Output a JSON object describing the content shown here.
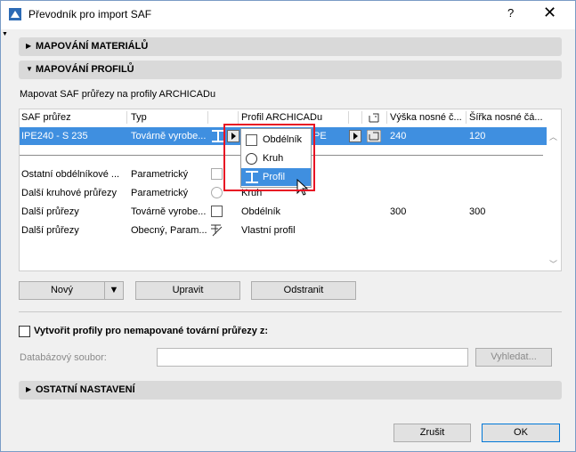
{
  "window": {
    "title": "Převodník pro import SAF",
    "help": "?",
    "close": "✕"
  },
  "sections": {
    "materials": "MAPOVÁNÍ MATERIÁLŮ",
    "profiles": "MAPOVÁNÍ PROFILŮ",
    "other": "OSTATNÍ NASTAVENÍ"
  },
  "map_label": "Mapovat SAF průřezy na profily ARCHICADu",
  "table": {
    "headers": [
      "SAF průřez",
      "Typ",
      "Profil ARCHICADu",
      "Výška nosné č...",
      "Šířka nosné čá..."
    ],
    "selected_row": {
      "saf": "IPE240 - S 235",
      "type": "Továrně vyrobe...",
      "profile_tail": "PE",
      "height": "240",
      "width": "120"
    },
    "rows": [
      {
        "saf": "Ostatní obdélníkové ...",
        "type": "Parametrický",
        "profile": "",
        "height": "",
        "width": ""
      },
      {
        "saf": "Další kruhové průřezy",
        "type": "Parametrický",
        "profile": "Kruh",
        "height": "",
        "width": ""
      },
      {
        "saf": "Další průřezy",
        "type": "Továrně vyrobe...",
        "profile": "Obdélník",
        "height": "300",
        "width": "300"
      },
      {
        "saf": "Další průřezy",
        "type": "Obecný, Param...",
        "profile": "Vlastní profil",
        "height": "",
        "width": ""
      }
    ]
  },
  "popup": {
    "items": [
      "Obdélník",
      "Kruh",
      "Profil"
    ],
    "selected": "Profil"
  },
  "buttons": {
    "new": "Nový",
    "edit": "Upravit",
    "remove": "Odstranit",
    "browse": "Vyhledat...",
    "cancel": "Zrušit",
    "ok": "OK"
  },
  "create_profiles": "Vytvořit profily pro nemapované tovární průřezy z:",
  "db_file_label": "Databázový soubor:",
  "db_file_value": "",
  "colors": {
    "selection": "#3f8fe0",
    "highlight_box": "#e81123",
    "section_bg": "#d9d9d9"
  }
}
